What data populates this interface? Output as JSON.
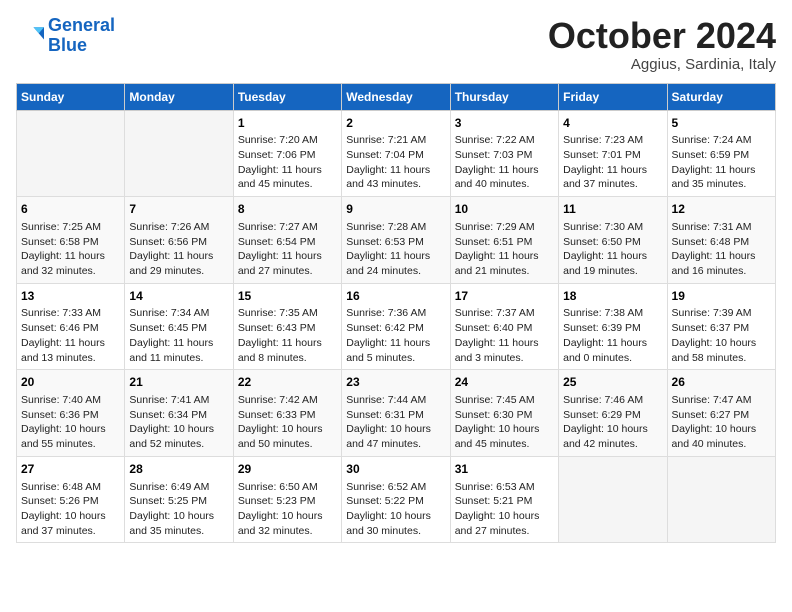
{
  "logo": {
    "line1": "General",
    "line2": "Blue"
  },
  "title": "October 2024",
  "subtitle": "Aggius, Sardinia, Italy",
  "weekdays": [
    "Sunday",
    "Monday",
    "Tuesday",
    "Wednesday",
    "Thursday",
    "Friday",
    "Saturday"
  ],
  "weeks": [
    [
      {
        "day": "",
        "sunrise": "",
        "sunset": "",
        "daylight": ""
      },
      {
        "day": "",
        "sunrise": "",
        "sunset": "",
        "daylight": ""
      },
      {
        "day": "1",
        "sunrise": "Sunrise: 7:20 AM",
        "sunset": "Sunset: 7:06 PM",
        "daylight": "Daylight: 11 hours and 45 minutes."
      },
      {
        "day": "2",
        "sunrise": "Sunrise: 7:21 AM",
        "sunset": "Sunset: 7:04 PM",
        "daylight": "Daylight: 11 hours and 43 minutes."
      },
      {
        "day": "3",
        "sunrise": "Sunrise: 7:22 AM",
        "sunset": "Sunset: 7:03 PM",
        "daylight": "Daylight: 11 hours and 40 minutes."
      },
      {
        "day": "4",
        "sunrise": "Sunrise: 7:23 AM",
        "sunset": "Sunset: 7:01 PM",
        "daylight": "Daylight: 11 hours and 37 minutes."
      },
      {
        "day": "5",
        "sunrise": "Sunrise: 7:24 AM",
        "sunset": "Sunset: 6:59 PM",
        "daylight": "Daylight: 11 hours and 35 minutes."
      }
    ],
    [
      {
        "day": "6",
        "sunrise": "Sunrise: 7:25 AM",
        "sunset": "Sunset: 6:58 PM",
        "daylight": "Daylight: 11 hours and 32 minutes."
      },
      {
        "day": "7",
        "sunrise": "Sunrise: 7:26 AM",
        "sunset": "Sunset: 6:56 PM",
        "daylight": "Daylight: 11 hours and 29 minutes."
      },
      {
        "day": "8",
        "sunrise": "Sunrise: 7:27 AM",
        "sunset": "Sunset: 6:54 PM",
        "daylight": "Daylight: 11 hours and 27 minutes."
      },
      {
        "day": "9",
        "sunrise": "Sunrise: 7:28 AM",
        "sunset": "Sunset: 6:53 PM",
        "daylight": "Daylight: 11 hours and 24 minutes."
      },
      {
        "day": "10",
        "sunrise": "Sunrise: 7:29 AM",
        "sunset": "Sunset: 6:51 PM",
        "daylight": "Daylight: 11 hours and 21 minutes."
      },
      {
        "day": "11",
        "sunrise": "Sunrise: 7:30 AM",
        "sunset": "Sunset: 6:50 PM",
        "daylight": "Daylight: 11 hours and 19 minutes."
      },
      {
        "day": "12",
        "sunrise": "Sunrise: 7:31 AM",
        "sunset": "Sunset: 6:48 PM",
        "daylight": "Daylight: 11 hours and 16 minutes."
      }
    ],
    [
      {
        "day": "13",
        "sunrise": "Sunrise: 7:33 AM",
        "sunset": "Sunset: 6:46 PM",
        "daylight": "Daylight: 11 hours and 13 minutes."
      },
      {
        "day": "14",
        "sunrise": "Sunrise: 7:34 AM",
        "sunset": "Sunset: 6:45 PM",
        "daylight": "Daylight: 11 hours and 11 minutes."
      },
      {
        "day": "15",
        "sunrise": "Sunrise: 7:35 AM",
        "sunset": "Sunset: 6:43 PM",
        "daylight": "Daylight: 11 hours and 8 minutes."
      },
      {
        "day": "16",
        "sunrise": "Sunrise: 7:36 AM",
        "sunset": "Sunset: 6:42 PM",
        "daylight": "Daylight: 11 hours and 5 minutes."
      },
      {
        "day": "17",
        "sunrise": "Sunrise: 7:37 AM",
        "sunset": "Sunset: 6:40 PM",
        "daylight": "Daylight: 11 hours and 3 minutes."
      },
      {
        "day": "18",
        "sunrise": "Sunrise: 7:38 AM",
        "sunset": "Sunset: 6:39 PM",
        "daylight": "Daylight: 11 hours and 0 minutes."
      },
      {
        "day": "19",
        "sunrise": "Sunrise: 7:39 AM",
        "sunset": "Sunset: 6:37 PM",
        "daylight": "Daylight: 10 hours and 58 minutes."
      }
    ],
    [
      {
        "day": "20",
        "sunrise": "Sunrise: 7:40 AM",
        "sunset": "Sunset: 6:36 PM",
        "daylight": "Daylight: 10 hours and 55 minutes."
      },
      {
        "day": "21",
        "sunrise": "Sunrise: 7:41 AM",
        "sunset": "Sunset: 6:34 PM",
        "daylight": "Daylight: 10 hours and 52 minutes."
      },
      {
        "day": "22",
        "sunrise": "Sunrise: 7:42 AM",
        "sunset": "Sunset: 6:33 PM",
        "daylight": "Daylight: 10 hours and 50 minutes."
      },
      {
        "day": "23",
        "sunrise": "Sunrise: 7:44 AM",
        "sunset": "Sunset: 6:31 PM",
        "daylight": "Daylight: 10 hours and 47 minutes."
      },
      {
        "day": "24",
        "sunrise": "Sunrise: 7:45 AM",
        "sunset": "Sunset: 6:30 PM",
        "daylight": "Daylight: 10 hours and 45 minutes."
      },
      {
        "day": "25",
        "sunrise": "Sunrise: 7:46 AM",
        "sunset": "Sunset: 6:29 PM",
        "daylight": "Daylight: 10 hours and 42 minutes."
      },
      {
        "day": "26",
        "sunrise": "Sunrise: 7:47 AM",
        "sunset": "Sunset: 6:27 PM",
        "daylight": "Daylight: 10 hours and 40 minutes."
      }
    ],
    [
      {
        "day": "27",
        "sunrise": "Sunrise: 6:48 AM",
        "sunset": "Sunset: 5:26 PM",
        "daylight": "Daylight: 10 hours and 37 minutes."
      },
      {
        "day": "28",
        "sunrise": "Sunrise: 6:49 AM",
        "sunset": "Sunset: 5:25 PM",
        "daylight": "Daylight: 10 hours and 35 minutes."
      },
      {
        "day": "29",
        "sunrise": "Sunrise: 6:50 AM",
        "sunset": "Sunset: 5:23 PM",
        "daylight": "Daylight: 10 hours and 32 minutes."
      },
      {
        "day": "30",
        "sunrise": "Sunrise: 6:52 AM",
        "sunset": "Sunset: 5:22 PM",
        "daylight": "Daylight: 10 hours and 30 minutes."
      },
      {
        "day": "31",
        "sunrise": "Sunrise: 6:53 AM",
        "sunset": "Sunset: 5:21 PM",
        "daylight": "Daylight: 10 hours and 27 minutes."
      },
      {
        "day": "",
        "sunrise": "",
        "sunset": "",
        "daylight": ""
      },
      {
        "day": "",
        "sunrise": "",
        "sunset": "",
        "daylight": ""
      }
    ]
  ]
}
